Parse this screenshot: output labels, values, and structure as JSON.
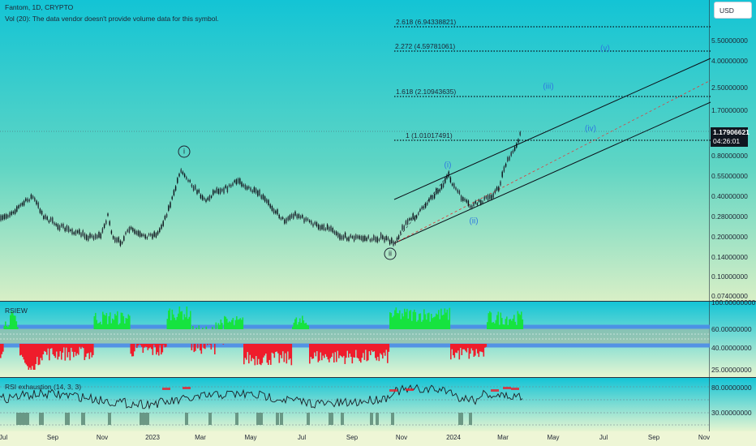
{
  "header": {
    "symbol_line": "Fantom, 1D, CRYPTO",
    "volume_note": "Vol (20): The data vendor doesn't provide volume data for this symbol."
  },
  "currency_button": "USD",
  "price_axis": [
    "5.50000000",
    "4.00000000",
    "2.50000000",
    "1.70000000",
    "0.80000000",
    "0.55000000",
    "0.40000000",
    "0.28000000",
    "0.20000000",
    "0.14000000",
    "0.10000000",
    "0.07400000"
  ],
  "price_tag": {
    "price": "1.17906621",
    "countdown": "04:26:01"
  },
  "fib_levels": [
    {
      "label": "2.618 (6.94338821)"
    },
    {
      "label": "2.272 (4.59781061)"
    },
    {
      "label": "1.618 (2.10943635)"
    },
    {
      "label": "1 (1.01017491)"
    }
  ],
  "waves": [
    {
      "label": "(i)"
    },
    {
      "label": "(ii)"
    },
    {
      "label": "(iii)"
    },
    {
      "label": "(iv)"
    },
    {
      "label": "(v)"
    },
    {
      "label": "i"
    },
    {
      "label": "ii"
    }
  ],
  "rsiew_pane": {
    "title": "RSIEW",
    "axis": [
      "100.00000000",
      "60.00000000",
      "40.00000000",
      "25.00000000"
    ]
  },
  "rsi_exhaustion_pane": {
    "title": "RSI exhaustion (14, 3, 3)",
    "axis": [
      "80.00000000",
      "30.00000000"
    ]
  },
  "time_axis": [
    "Jul",
    "Sep",
    "Nov",
    "2023",
    "Mar",
    "May",
    "Jul",
    "Sep",
    "Nov",
    "2024",
    "Mar",
    "May",
    "Jul",
    "Sep",
    "Nov"
  ],
  "colors": {
    "bg_top": "#17c7d6",
    "bg_bottom": "#eef6cf",
    "wave_blue": "#2f79e0",
    "rsi_green": "#16e33f",
    "rsi_red": "#ef1c2b",
    "band_blue": "#4a86e8"
  }
}
